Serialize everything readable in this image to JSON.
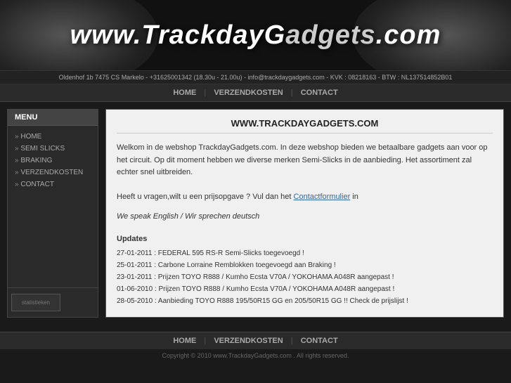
{
  "header": {
    "site_title_part1": "www.TrackdayG",
    "site_title_part2": "adgets.com",
    "info_bar": "Oldenhof 1b 7475 CS Markelo - +31625001342 (18.30u - 21.00u) - info@trackdaygadgets.com - KVK : 08218163 - BTW : NL137514852B01"
  },
  "top_nav": {
    "items": [
      {
        "label": "HOME",
        "href": "#"
      },
      {
        "label": "VERZENDKOSTEN",
        "href": "#"
      },
      {
        "label": "CONTACT",
        "href": "#"
      }
    ]
  },
  "sidebar": {
    "menu_header": "MENU",
    "items": [
      {
        "label": "HOME"
      },
      {
        "label": "SEMI SLICKS"
      },
      {
        "label": "BRAKING"
      },
      {
        "label": "VERZENDKOSTEN"
      },
      {
        "label": "CONTACT"
      }
    ],
    "stats_label": "statistieken"
  },
  "content": {
    "title": "WWW.TRACKDAYGADGETS.COM",
    "intro_p1": "Welkom in de webshop TrackdayGadgets.com. In deze webshop bieden we betaalbare gadgets aan voor op het circuit. Op dit moment hebben we diverse merken Semi-Slicks in de aanbieding. Het assortiment zal echter snel uitbreiden.",
    "intro_p2_pre": "Heeft u vragen,wilt u een prijsopgave ? Vul dan het ",
    "intro_link": "Contactformulier",
    "intro_p2_post": " in",
    "speak": "We speak English / Wir sprechen deutsch",
    "updates_title": "Updates",
    "updates": [
      "27-01-2011 : FEDERAL 595 RS-R Semi-Slicks toegevoegd !",
      "25-01-2011 : Carbone Lorraine Remblokken toegevoegd aan Braking !",
      "23-01-2011 : Prijzen TOYO R888 / Kumho Ecsta V70A / YOKOHAMA A048R aangepast !",
      "01-06-2010 : Prijzen TOYO R888 / Kumho Ecsta V70A / YOKOHAMA A048R aangepast !",
      "28-05-2010 : Aanbieding TOYO R888 195/50R15 GG en 205/50R15 GG !! Check de prijslijst !"
    ]
  },
  "bottom_nav": {
    "items": [
      {
        "label": "HOME"
      },
      {
        "label": "VERZENDKOSTEN"
      },
      {
        "label": "CONTACT"
      }
    ]
  },
  "copyright": "Copyright © 2010 www.TrackdayGadgets.com . All rights reserved."
}
